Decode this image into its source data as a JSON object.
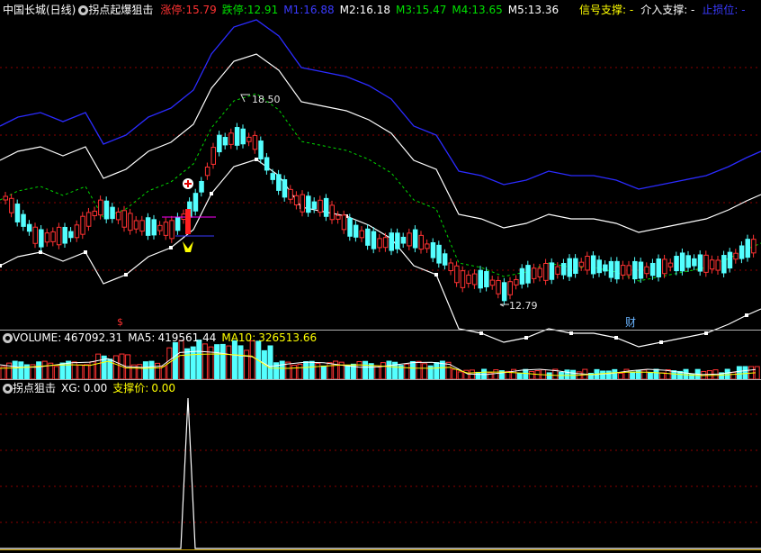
{
  "main_header": {
    "stock": "中国长城(日线)",
    "indicator": "拐点起爆狙击",
    "zt_label": "涨停:",
    "zt_value": "15.79",
    "dt_label": "跌停:",
    "dt_value": "12.91",
    "m1_label": "M1:",
    "m1_value": "16.88",
    "m2_label": "M2:",
    "m2_value": "16.18",
    "m3_label": "M3:",
    "m3_value": "15.47",
    "m4_label": "M4:",
    "m4_value": "13.65",
    "m5_label": "M5:",
    "m5_value": "13.36",
    "signal": "信号支撑: -",
    "enter": "介入支撑: -",
    "stop": "止损位: -"
  },
  "annotations": {
    "high_price": "18.50",
    "low_price": "12.79",
    "marker_s": "$",
    "marker_cai": "财"
  },
  "volume_header": {
    "label": "VOLUME:",
    "value": "467092.31",
    "ma5_label": "MA5:",
    "ma5_value": "419561.44",
    "ma10_label": "MA10:",
    "ma10_value": "326513.66"
  },
  "signal_header": {
    "name": "拐点狙击",
    "xg_label": "XG:",
    "xg_value": "0.00",
    "support_label": "支撑价:",
    "support_value": "0.00"
  },
  "colors": {
    "up": "#ff3232",
    "down": "#54ffff",
    "blue_line": "#2b2bff",
    "white_line": "#ffffff",
    "green_dash": "#00d800",
    "yellow": "#ffff00",
    "magenta": "#ff00ff",
    "grid": "#8b0000"
  }
}
